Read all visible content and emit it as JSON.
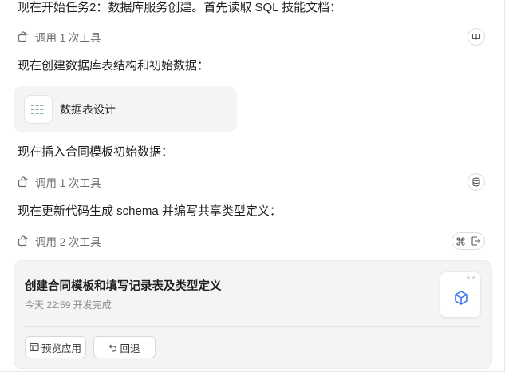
{
  "messages": {
    "m1": "现在开始任务2：数据库服务创建。首先读取 SQL 技能文档：",
    "m2": "现在创建数据库表结构和初始数据：",
    "m3": "现在插入合同模板初始数据：",
    "m4": "现在更新代码生成 schema 并编写共享类型定义："
  },
  "tool_calls": {
    "t1": "调用 1 次工具",
    "t2": "调用 1 次工具",
    "t3": "调用 2 次工具"
  },
  "file_card": {
    "name": "数据表设计",
    "icon": "table-rows-icon"
  },
  "result_card": {
    "title": "创建合同模板和填写记录表及类型定义",
    "subtitle": "今天 22:59 开发完成",
    "preview_label": "预览应用",
    "rollback_label": "回退",
    "thumb_icon": "cube-icon"
  },
  "colors": {
    "card_bg": "#f4f4f5",
    "accent_blue": "#2f6fed",
    "icon_green": "#5a9a78",
    "text_muted": "#6b6b6b"
  }
}
